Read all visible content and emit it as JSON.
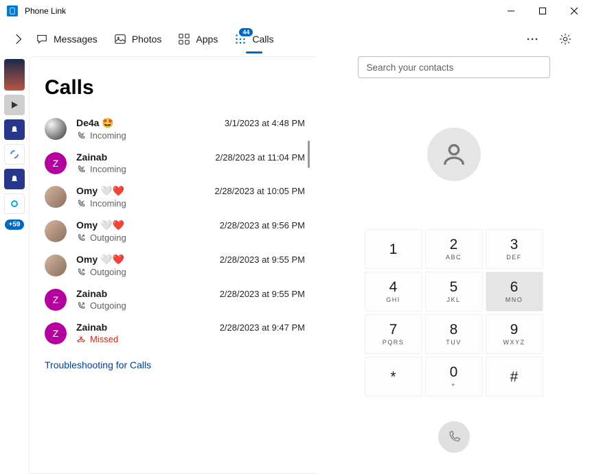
{
  "app": {
    "title": "Phone Link"
  },
  "nav": {
    "tabs": [
      {
        "label": "Messages"
      },
      {
        "label": "Photos"
      },
      {
        "label": "Apps"
      },
      {
        "label": "Calls",
        "badge": "44"
      }
    ]
  },
  "side": {
    "count_badge": "+59"
  },
  "calls": {
    "heading": "Calls",
    "troubleshoot": "Troubleshooting for Calls",
    "items": [
      {
        "name": "De4a 🤩",
        "time": "3/1/2023 at 4:48 PM",
        "type": "Incoming",
        "avatar": "img1"
      },
      {
        "name": "Zainab",
        "time": "2/28/2023 at 11:04 PM",
        "type": "Incoming",
        "avatar": "purple",
        "initial": "Z"
      },
      {
        "name": "Omy 🤍❤️",
        "time": "2/28/2023 at 10:05 PM",
        "type": "Incoming",
        "avatar": "img2"
      },
      {
        "name": "Omy 🤍❤️",
        "time": "2/28/2023 at 9:56 PM",
        "type": "Outgoing",
        "avatar": "img2"
      },
      {
        "name": "Omy 🤍❤️",
        "time": "2/28/2023 at 9:55 PM",
        "type": "Outgoing",
        "avatar": "img2"
      },
      {
        "name": "Zainab",
        "time": "2/28/2023 at 9:55 PM",
        "type": "Outgoing",
        "avatar": "purple",
        "initial": "Z"
      },
      {
        "name": "Zainab",
        "time": "2/28/2023 at 9:47 PM",
        "type": "Missed",
        "avatar": "purple",
        "initial": "Z"
      }
    ]
  },
  "dialer": {
    "search_placeholder": "Search your contacts",
    "keys": [
      {
        "d": "1",
        "l": ""
      },
      {
        "d": "2",
        "l": "ABC"
      },
      {
        "d": "3",
        "l": "DEF"
      },
      {
        "d": "4",
        "l": "GHI"
      },
      {
        "d": "5",
        "l": "JKL"
      },
      {
        "d": "6",
        "l": "MNO"
      },
      {
        "d": "7",
        "l": "PQRS"
      },
      {
        "d": "8",
        "l": "TUV"
      },
      {
        "d": "9",
        "l": "WXYZ"
      },
      {
        "d": "*",
        "l": ""
      },
      {
        "d": "0",
        "l": "+"
      },
      {
        "d": "#",
        "l": ""
      }
    ]
  }
}
